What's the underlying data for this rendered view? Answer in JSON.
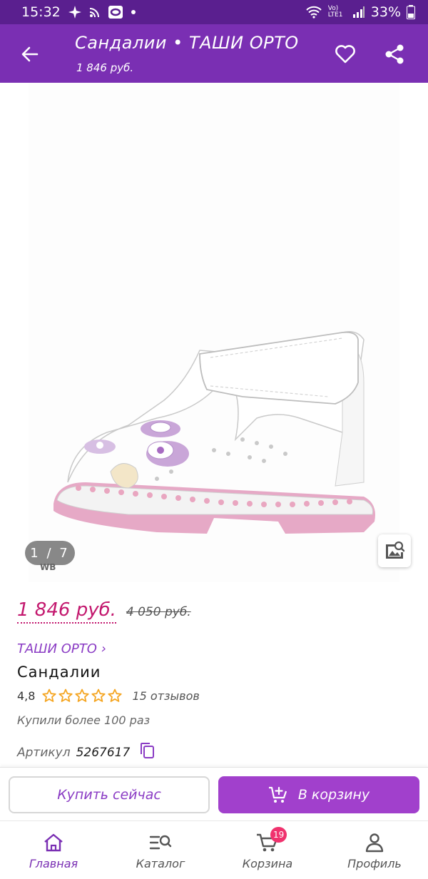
{
  "status_bar": {
    "time": "15:32",
    "network": "Vo) LTE1",
    "battery": "33%"
  },
  "app_bar": {
    "title": "Сандалии • ТАШИ ОРТО",
    "subtitle": "1 846 руб."
  },
  "gallery": {
    "counter": "1 / 7",
    "watermark": "WB"
  },
  "product": {
    "price_now": "1 846 руб.",
    "price_old": "4 050 руб.",
    "brand": "ТАШИ ОРТО ›",
    "name": "Сандалии",
    "rating": "4,8",
    "stars": 5,
    "reviews": "15 отзывов",
    "bought": "Купили более 100 раз",
    "article_label": "Артикул",
    "article_value": "5267617"
  },
  "actions": {
    "buy_now": "Купить сейчас",
    "add_to_cart": "В корзину"
  },
  "bottom_nav": {
    "items": [
      {
        "label": "Главная",
        "icon": "home-icon"
      },
      {
        "label": "Каталог",
        "icon": "catalog-search-icon"
      },
      {
        "label": "Корзина",
        "icon": "cart-icon",
        "badge": "19"
      },
      {
        "label": "Профиль",
        "icon": "profile-icon"
      }
    ]
  },
  "colors": {
    "status_bar": "#5a1f8f",
    "app_bar": "#7a2fb3",
    "price": "#c3186e",
    "accent": "#a140cc",
    "badge": "#f0326e",
    "star": "#f5a623"
  }
}
